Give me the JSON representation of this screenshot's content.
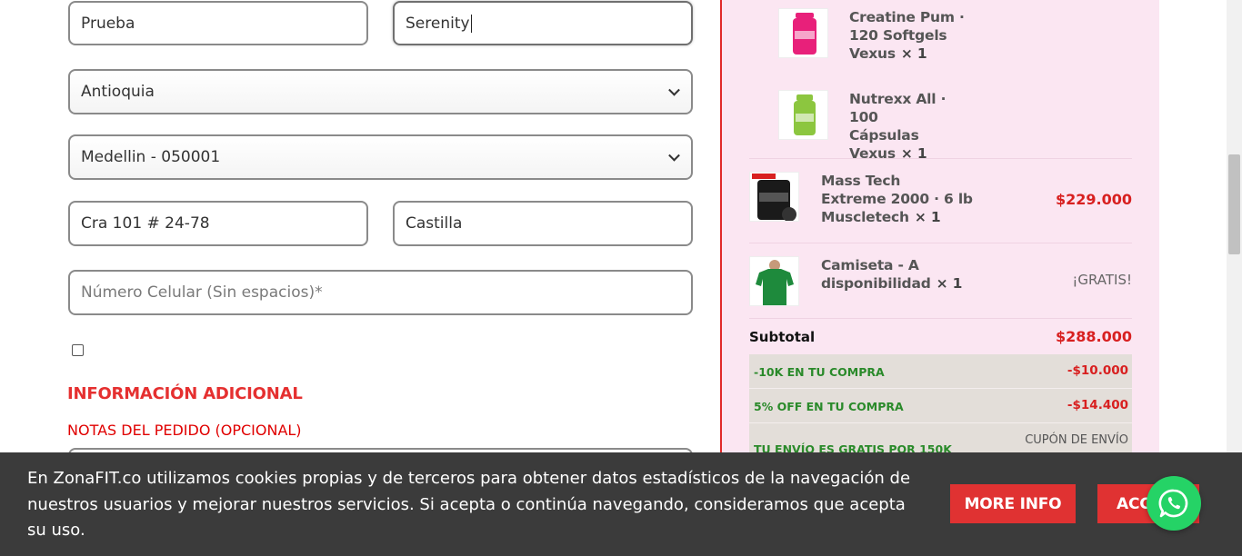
{
  "form": {
    "first_name": "Prueba",
    "last_name": "Serenity",
    "department": "Antioquia",
    "city": "Medellin - 050001",
    "address": "Cra 101 # 24-78",
    "address2": "Castilla",
    "phone_placeholder": "Número Celular (Sin espacios)*"
  },
  "additional": {
    "title": "INFORMACIÓN ADICIONAL",
    "notes_label": "NOTAS DEL PEDIDO (OPCIONAL)"
  },
  "order": {
    "items": [
      {
        "name_lines": [
          "Creatine Pum ·",
          "120 Softgels",
          "Vexus"
        ],
        "qty": "× 1",
        "price": "",
        "image": "creatine-bottle",
        "color": "#e8207a"
      },
      {
        "name_lines": [
          "Nutrexx All · 100",
          "Cápsulas",
          "Vexus"
        ],
        "qty": "× 1",
        "price": "",
        "image": "nutrexx-bottle",
        "color": "#8cc63f"
      },
      {
        "name_lines": [
          "Mass Tech",
          "Extreme 2000 · 6 lb",
          "Muscletech"
        ],
        "qty": "× 1",
        "price": "$229.000",
        "image": "mass-tech-tub",
        "color": "#1a1a1a"
      },
      {
        "name_lines": [
          "Camiseta - A",
          "disponibilidad"
        ],
        "qty": "× 1",
        "price": "¡GRATIS!",
        "image": "green-tshirt",
        "color": "#1e8a3c"
      }
    ],
    "subtotal_label": "Subtotal",
    "subtotal_value": "$288.000",
    "discounts": [
      {
        "label": "-10K EN TU COMPRA",
        "value": "-$10.000"
      },
      {
        "label": "5% OFF EN TU COMPRA",
        "value": "-$14.400"
      },
      {
        "label": "TU ENVÍO ES GRATIS POR 150K",
        "value": "CUPÓN DE ENVÍO"
      }
    ]
  },
  "cookie": {
    "text": "En ZonaFIT.co utilizamos cookies propias y de terceros para obtener datos estadísticos de la navegación de nuestros usuarios y mejorar nuestros servicios. Si acepta o continúa navegando, consideramos que acepta su uso.",
    "more_info": "MORE INFO",
    "accept": "ACC"
  },
  "colors": {
    "accent_red": "#e03232",
    "panel_bg": "#fbe6f2",
    "whatsapp": "#25d366",
    "discount_green": "#2a8a2a"
  },
  "icons": [
    "chevron-down-icon",
    "whatsapp-icon"
  ]
}
